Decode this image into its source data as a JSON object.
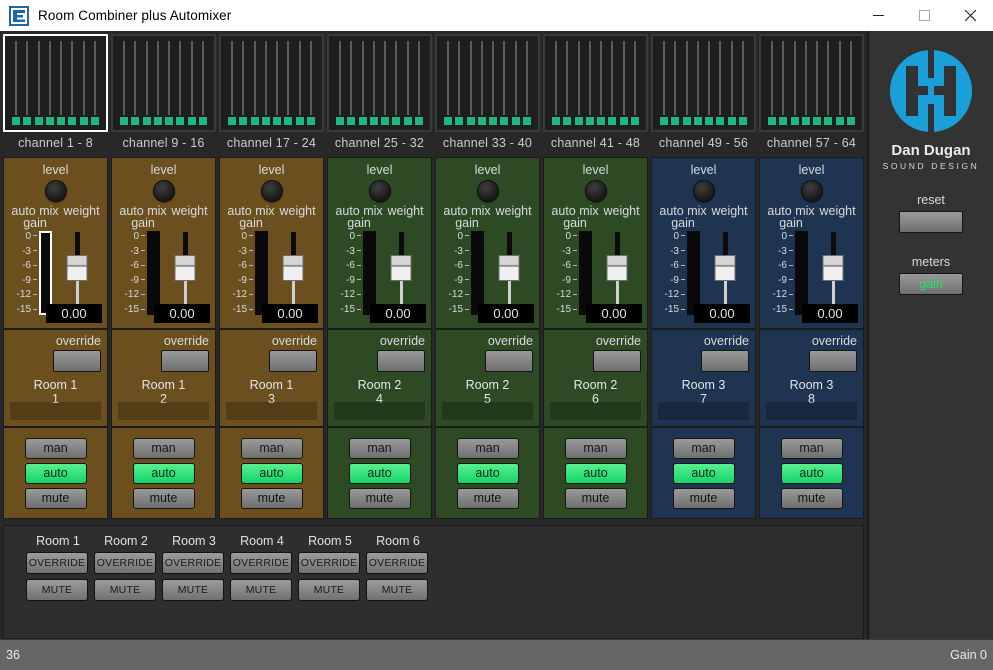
{
  "window": {
    "title": "Room Combiner plus Automixer",
    "icon": "app-icon",
    "minimize": "minimize-icon",
    "maximize": "maximize-icon",
    "close": "close-icon"
  },
  "tabs": [
    {
      "label": "channel  1 - 8",
      "selected": true
    },
    {
      "label": "channel  9 - 16",
      "selected": false
    },
    {
      "label": "channel 17 - 24",
      "selected": false
    },
    {
      "label": "channel 25 - 32",
      "selected": false
    },
    {
      "label": "channel 33 - 40",
      "selected": false
    },
    {
      "label": "channel 41 - 48",
      "selected": false
    },
    {
      "label": "channel 49 - 56",
      "selected": false
    },
    {
      "label": "channel 57 - 64",
      "selected": false
    }
  ],
  "strip_labels": {
    "level": "level",
    "auto_mix": "auto mix",
    "gain": "gain",
    "weight": "weight",
    "override": "override",
    "scale": [
      "0",
      "-3",
      "-6",
      "-9",
      "-12",
      "-15"
    ],
    "modes": [
      "man",
      "auto",
      "mute"
    ]
  },
  "channels": [
    {
      "number": "1",
      "room": "Room 1",
      "color": "brown",
      "weight_value": "0.00",
      "mode": "auto",
      "gain_focus": true
    },
    {
      "number": "2",
      "room": "Room 1",
      "color": "brown",
      "weight_value": "0.00",
      "mode": "auto",
      "gain_focus": false
    },
    {
      "number": "3",
      "room": "Room 1",
      "color": "brown",
      "weight_value": "0.00",
      "mode": "auto",
      "gain_focus": false
    },
    {
      "number": "4",
      "room": "Room 2",
      "color": "green",
      "weight_value": "0.00",
      "mode": "auto",
      "gain_focus": false
    },
    {
      "number": "5",
      "room": "Room 2",
      "color": "green",
      "weight_value": "0.00",
      "mode": "auto",
      "gain_focus": false
    },
    {
      "number": "6",
      "room": "Room 2",
      "color": "green",
      "weight_value": "0.00",
      "mode": "auto",
      "gain_focus": false
    },
    {
      "number": "7",
      "room": "Room 3",
      "color": "blue",
      "weight_value": "0.00",
      "mode": "auto",
      "gain_focus": false
    },
    {
      "number": "8",
      "room": "Room 3",
      "color": "blue",
      "weight_value": "0.00",
      "mode": "auto",
      "gain_focus": false
    }
  ],
  "rooms": [
    {
      "label": "Room 1",
      "override": "OVERRIDE",
      "mute": "MUTE"
    },
    {
      "label": "Room 2",
      "override": "OVERRIDE",
      "mute": "MUTE"
    },
    {
      "label": "Room 3",
      "override": "OVERRIDE",
      "mute": "MUTE"
    },
    {
      "label": "Room 4",
      "override": "OVERRIDE",
      "mute": "MUTE"
    },
    {
      "label": "Room 5",
      "override": "OVERRIDE",
      "mute": "MUTE"
    },
    {
      "label": "Room 6",
      "override": "OVERRIDE",
      "mute": "MUTE"
    }
  ],
  "panel": {
    "brand": "Dan Dugan",
    "brand_sub": "SOUND DESIGN",
    "logo_color": "#1a9fd9",
    "reset_label": "reset",
    "reset_button": "",
    "meters_label": "meters",
    "meters_value": "gain",
    "meters_value_color": "#25e06a"
  },
  "status": {
    "left": "36",
    "right": "Gain 0"
  },
  "colors": {
    "room1": "#6b4f1e",
    "room2": "#2d4a25",
    "room3": "#1e3450",
    "led_green": "#1fb97f",
    "active_green": "#14d468"
  }
}
